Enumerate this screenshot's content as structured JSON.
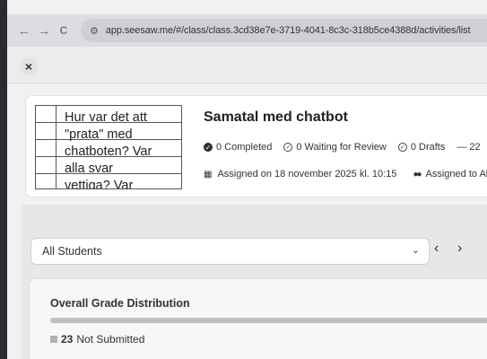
{
  "browser": {
    "back_icon": "←",
    "forward_icon": "→",
    "reload_icon": "C",
    "url": "app.seesaw.me/#/class/class.3cd38e7e-3719-4041-8c3c-318b5ce4388d/activities/list"
  },
  "toolbar": {
    "close_label": "×"
  },
  "activity": {
    "thumbnail_lines": [
      "Hur var det att",
      "\"prata\" med",
      "chatboten? Var",
      "alla svar",
      "vettiga? Var"
    ],
    "title": "Samatal med chatbot",
    "stats": {
      "completed": "0 Completed",
      "waiting": "0 Waiting for Review",
      "drafts": "0 Drafts",
      "extra": "— 22"
    },
    "assigned_on": "Assigned on 18 november 2025 kl. 10:15",
    "assigned_to": "Assigned to Al"
  },
  "filter": {
    "selected": "All Students",
    "prev_icon": "‹",
    "next_icon": "›"
  },
  "grade_distribution": {
    "title": "Overall Grade Distribution",
    "not_submitted_count": "23",
    "not_submitted_label": "Not Submitted",
    "not_submitted_fraction": 1.0
  }
}
